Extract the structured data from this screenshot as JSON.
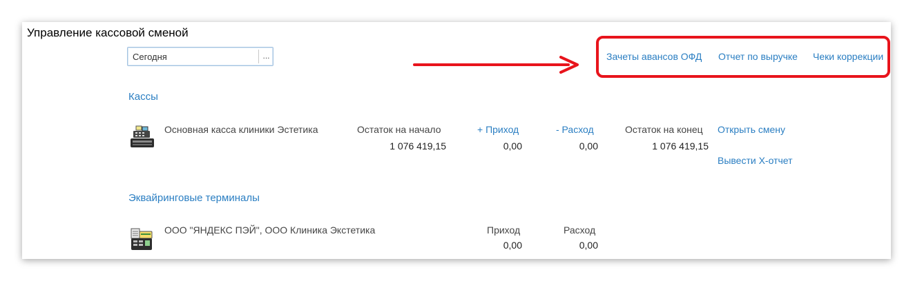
{
  "page": {
    "title": "Управление кассовой сменой"
  },
  "period": {
    "value": "Сегодня",
    "select_label": "..."
  },
  "top_links": {
    "advances": "Зачеты авансов ОФД",
    "revenue_report": "Отчет по выручке",
    "correction_checks": "Чеки коррекции"
  },
  "cash_registers": {
    "section_title": "Кассы",
    "items": [
      {
        "name": "Основная касса клиники Эстетика",
        "opening_label": "Остаток на начало",
        "opening_value": "1 076 419,15",
        "income_label": "+ Приход",
        "income_value": "0,00",
        "expense_label": "- Расход",
        "expense_value": "0,00",
        "closing_label": "Остаток на конец",
        "closing_value": "1 076 419,15",
        "open_shift": "Открыть смену",
        "x_report": "Вывести Х-отчет",
        "icon": "cash-register-icon"
      }
    ]
  },
  "terminals": {
    "section_title": "Эквайринговые терминалы",
    "items": [
      {
        "name": "ООО \"ЯНДЕКС ПЭЙ\", ООО Клиника Экстетика",
        "income_label": "Приход",
        "income_value": "0,00",
        "expense_label": "Расход",
        "expense_value": "0,00",
        "icon": "payment-terminal-icon"
      }
    ]
  },
  "colors": {
    "link": "#2a7ec2",
    "highlight": "#e8141c",
    "field_border": "#a3c2e0"
  }
}
